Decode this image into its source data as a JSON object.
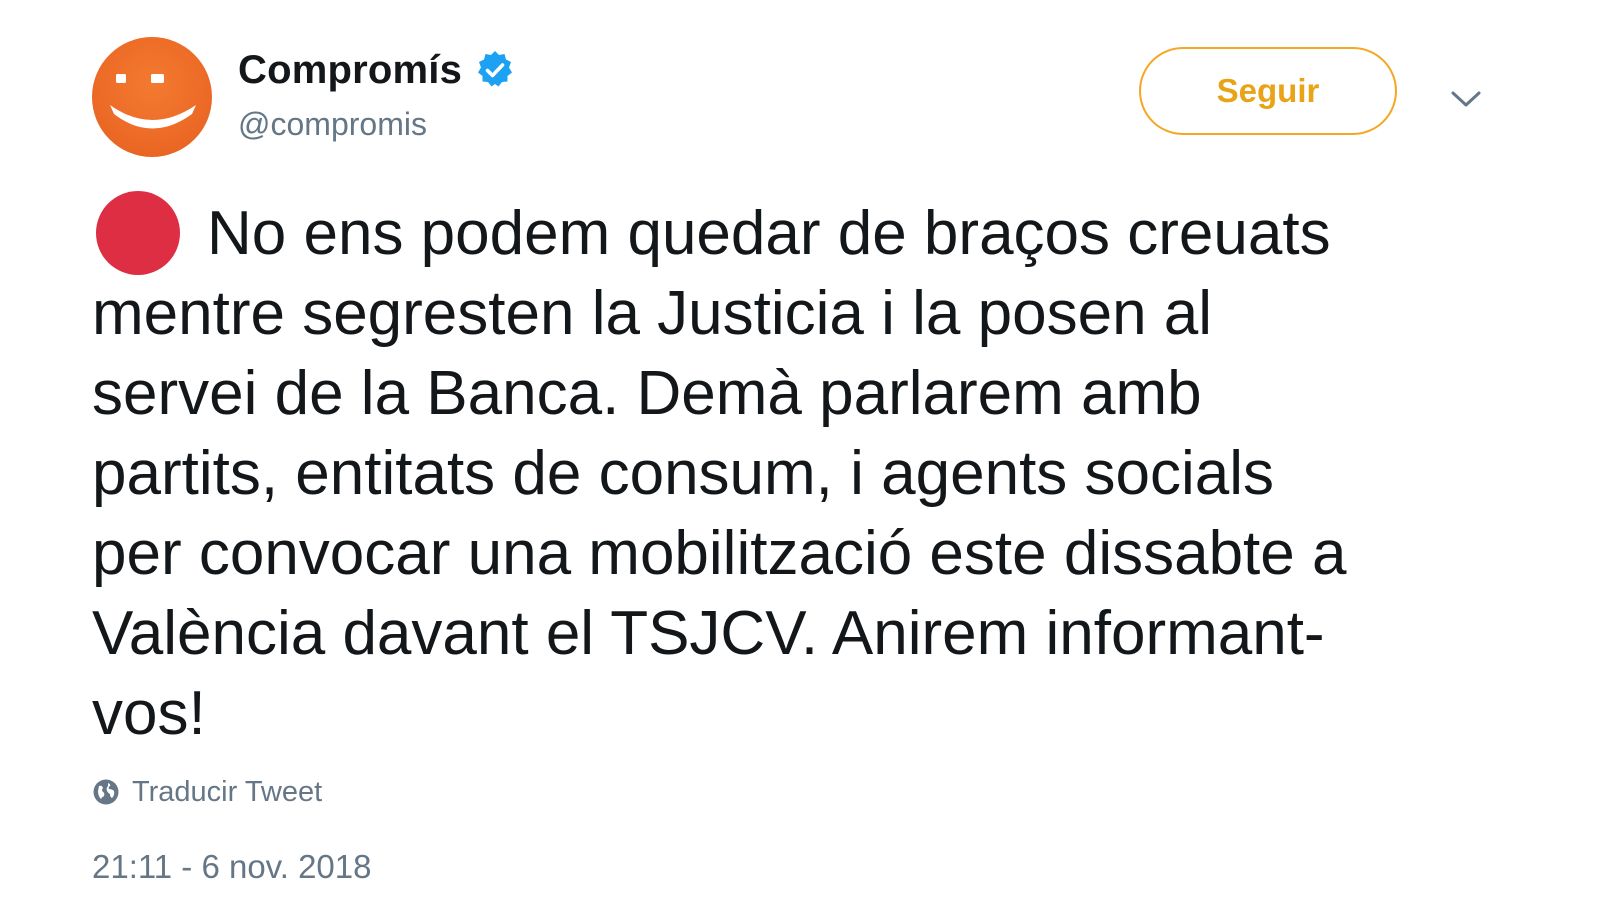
{
  "author": {
    "display_name": "Compromís",
    "handle": "@compromis",
    "verified": true,
    "avatar_icon": "smiley-logo-icon",
    "avatar_color": "#ec6a26"
  },
  "actions": {
    "follow_label": "Seguir",
    "follow_color": "#f5a623",
    "more_icon": "chevron-down-icon"
  },
  "tweet": {
    "emoji": "red-circle-icon",
    "emoji_color": "#dd2e44",
    "lines": [
      "No ens podem quedar de braços creuats",
      "mentre segresten la Justicia i la posen al",
      "servei de la Banca. Demà parlarem amb",
      "partits, entitats de consum, i agents socials",
      "per convocar una mobilització este dissabte a",
      "València davant el TSJCV. Anirem informant-",
      "vos!"
    ],
    "translate_label": "Traducir Tweet",
    "timestamp": "21:11 - 6 nov. 2018"
  }
}
